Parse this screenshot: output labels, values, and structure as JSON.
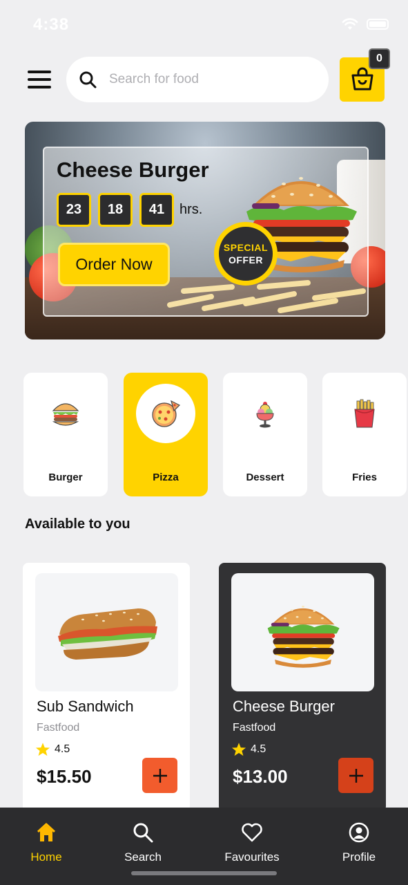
{
  "status_bar": {
    "time": "4:38"
  },
  "header": {
    "menu_icon": "hamburger-menu-icon",
    "search": {
      "placeholder": "Search for food",
      "value": ""
    },
    "cart": {
      "icon": "shopping-bag-icon",
      "count": "0"
    }
  },
  "banner": {
    "title": "Cheese Burger",
    "timer": {
      "hours": "23",
      "minutes": "18",
      "seconds": "41",
      "unit": "hrs."
    },
    "order_button": "Order Now",
    "badge": {
      "line1": "SPECIAL",
      "line2": "OFFER"
    }
  },
  "categories": [
    {
      "label": "Burger",
      "icon": "burger-icon",
      "active": false
    },
    {
      "label": "Pizza",
      "icon": "pizza-icon",
      "active": true
    },
    {
      "label": "Dessert",
      "icon": "ice-cream-icon",
      "active": false
    },
    {
      "label": "Fries",
      "icon": "fries-icon",
      "active": false
    }
  ],
  "section_title": "Available to you",
  "products": [
    {
      "name": "Sub Sandwich",
      "category": "Fastfood",
      "rating": "4.5",
      "price": "$15.50",
      "theme": "light"
    },
    {
      "name": "Cheese Burger",
      "category": "Fastfood",
      "rating": "4.5",
      "price": "$13.00",
      "theme": "dark"
    }
  ],
  "tabbar": [
    {
      "label": "Home",
      "icon": "home-icon",
      "active": true
    },
    {
      "label": "Search",
      "icon": "search-icon",
      "active": false
    },
    {
      "label": "Favourites",
      "icon": "heart-icon",
      "active": false
    },
    {
      "label": "Profile",
      "icon": "profile-icon",
      "active": false
    }
  ],
  "colors": {
    "accent": "#ffd300",
    "dark": "#2c2c2e",
    "add_button": "#f25c2d",
    "background": "#efeff1"
  }
}
